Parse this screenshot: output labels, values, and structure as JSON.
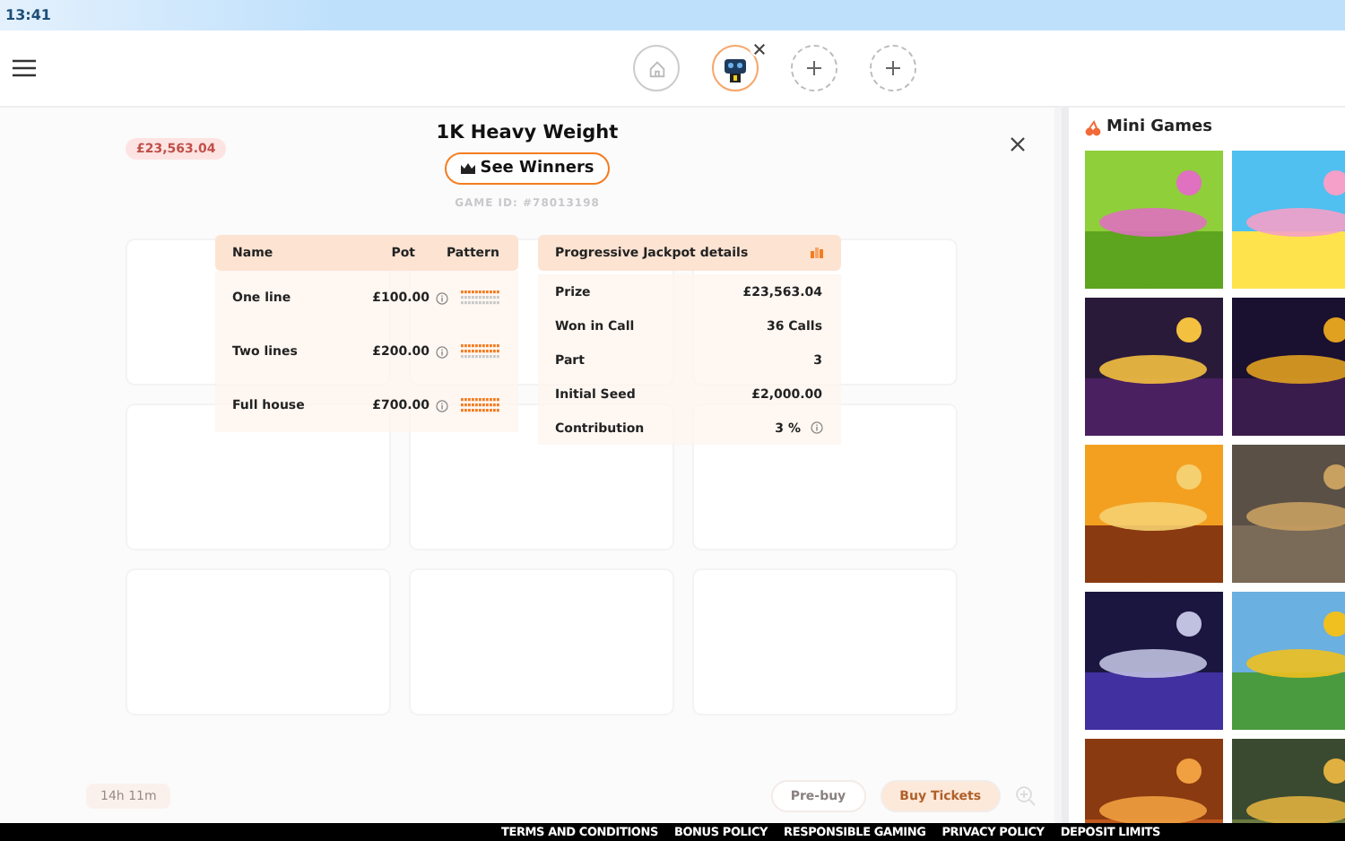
{
  "status_bar": {
    "time": "13:41"
  },
  "header": {
    "tabs": [
      {
        "kind": "home",
        "selected": false
      },
      {
        "kind": "game",
        "selected": true
      },
      {
        "kind": "add",
        "selected": false
      },
      {
        "kind": "add",
        "selected": false
      }
    ]
  },
  "background": {
    "jackpot_badge": "£23,563.04",
    "countdown": "14h 11m",
    "buttons": [
      "Pre-buy",
      "Buy Tickets"
    ]
  },
  "modal": {
    "title": "1K Heavy Weight",
    "winners_button": "See Winners",
    "game_id": "GAME ID: #78013198",
    "prizes": {
      "columns": [
        "Name",
        "Pot",
        "Pattern"
      ],
      "rows": [
        {
          "name": "One line",
          "pot": "£100.00",
          "pattern_rows": [
            true,
            false,
            false
          ]
        },
        {
          "name": "Two lines",
          "pot": "£200.00",
          "pattern_rows": [
            true,
            true,
            false
          ]
        },
        {
          "name": "Full house",
          "pot": "£700.00",
          "pattern_rows": [
            true,
            true,
            true
          ]
        }
      ]
    },
    "jackpot": {
      "title": "Progressive Jackpot details",
      "rows": [
        {
          "label": "Prize",
          "value": "£23,563.04",
          "info": false
        },
        {
          "label": "Won in Call",
          "value": "36 Calls",
          "info": false
        },
        {
          "label": "Part",
          "value": "3",
          "info": false
        },
        {
          "label": "Initial Seed",
          "value": "£2,000.00",
          "info": false
        },
        {
          "label": "Contribution",
          "value": "3 %",
          "info": true
        }
      ]
    }
  },
  "mini_games": {
    "title": "Mini Games"
  },
  "footer": {
    "links": [
      "TERMS AND CONDITIONS",
      "BONUS POLICY",
      "RESPONSIBLE GAMING",
      "PRIVACY POLICY",
      "DEPOSIT LIMITS"
    ]
  }
}
